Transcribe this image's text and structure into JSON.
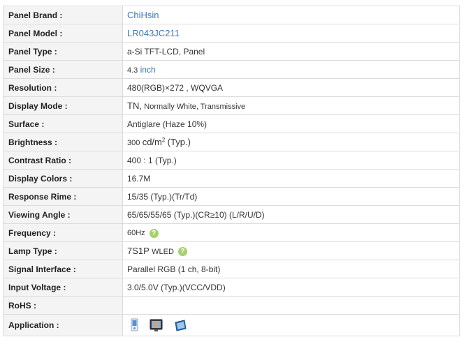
{
  "rows": {
    "brand": {
      "label": "Panel Brand :",
      "value": "ChiHsin"
    },
    "model": {
      "label": "Panel Model :",
      "value": "LR043JC211"
    },
    "type": {
      "label": "Panel Type :",
      "value": "a-Si TFT-LCD, Panel"
    },
    "size": {
      "label": "Panel Size :",
      "num": "4.3",
      "unit": "inch"
    },
    "resolution": {
      "label": "Resolution :",
      "value": "480(RGB)×272 , WQVGA"
    },
    "display_mode": {
      "label": "Display Mode :",
      "main": "TN,",
      "detail": "Normally White, Transmissive"
    },
    "surface": {
      "label": "Surface :",
      "value": "Antiglare (Haze 10%)"
    },
    "brightness": {
      "label": "Brightness :",
      "num": "300",
      "unit": "cd/m",
      "sup": "2",
      "note": "(Typ.)"
    },
    "contrast": {
      "label": "Contrast Ratio :",
      "value": "400 : 1 (Typ.)"
    },
    "colors": {
      "label": "Display Colors :",
      "value": "16.7M"
    },
    "response": {
      "label": "Response Rime :",
      "value": "15/35 (Typ.)(Tr/Td)"
    },
    "viewing": {
      "label": "Viewing Angle :",
      "value": "65/65/55/65 (Typ.)(CR≥10) (L/R/U/D)"
    },
    "frequency": {
      "label": "Frequency :",
      "value": "60Hz",
      "help": "?"
    },
    "lamp": {
      "label": "Lamp Type :",
      "main": "7S1P",
      "detail": "WLED",
      "help": "?"
    },
    "signal": {
      "label": "Signal Interface :",
      "value": "Parallel RGB (1 ch, 8-bit)"
    },
    "voltage": {
      "label": "Input Voltage :",
      "value": "3.0/5.0V (Typ.)(VCC/VDD)"
    },
    "rohs": {
      "label": "RoHS :",
      "value": ""
    },
    "application": {
      "label": "Application :",
      "icons": [
        "handheld-device-icon",
        "monitor-icon",
        "tablet-icon"
      ]
    }
  }
}
